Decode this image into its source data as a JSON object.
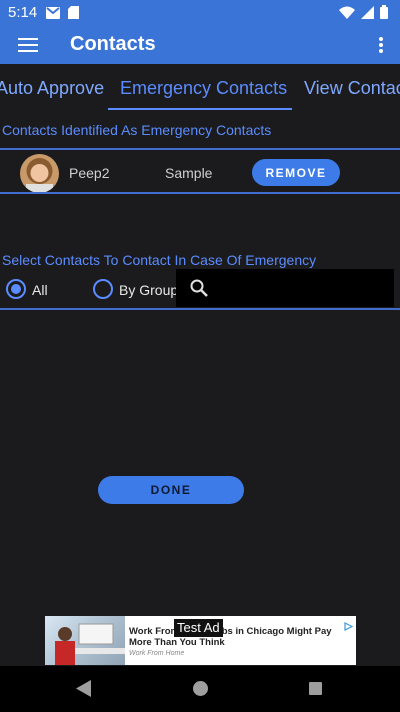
{
  "status_bar": {
    "time": "5:14",
    "icons": [
      "gmail-icon",
      "sim-card-icon",
      "wifi-icon",
      "signal-icon",
      "battery-icon"
    ]
  },
  "app_bar": {
    "title": "Contacts",
    "menu_icon": "hamburger-menu-icon",
    "overflow_icon": "more-vert-icon"
  },
  "tabs": [
    {
      "label": "Auto Approve",
      "selected": false
    },
    {
      "label": "Emergency Contacts",
      "selected": true
    },
    {
      "label": "View Contacts",
      "selected": false
    }
  ],
  "emergency_section": {
    "heading": "Contacts Identified As Emergency Contacts",
    "contacts": [
      {
        "name": "Peep2",
        "detail": "Sample",
        "action_label": "REMOVE"
      }
    ]
  },
  "select_section": {
    "heading": "Select Contacts To Contact In Case Of Emergency",
    "options": [
      {
        "label": "All",
        "selected": true
      },
      {
        "label": "By Group",
        "selected": false
      }
    ],
    "search_placeholder": ""
  },
  "done_label": "DONE",
  "ad": {
    "test_label": "Test Ad",
    "headline": "Work From Home Jobs in Chicago Might Pay More Than You Think",
    "source": "Work From Home"
  },
  "colors": {
    "accent": "#3a74d6",
    "tab_text": "#5b8cff",
    "background": "#1b1b1d"
  }
}
